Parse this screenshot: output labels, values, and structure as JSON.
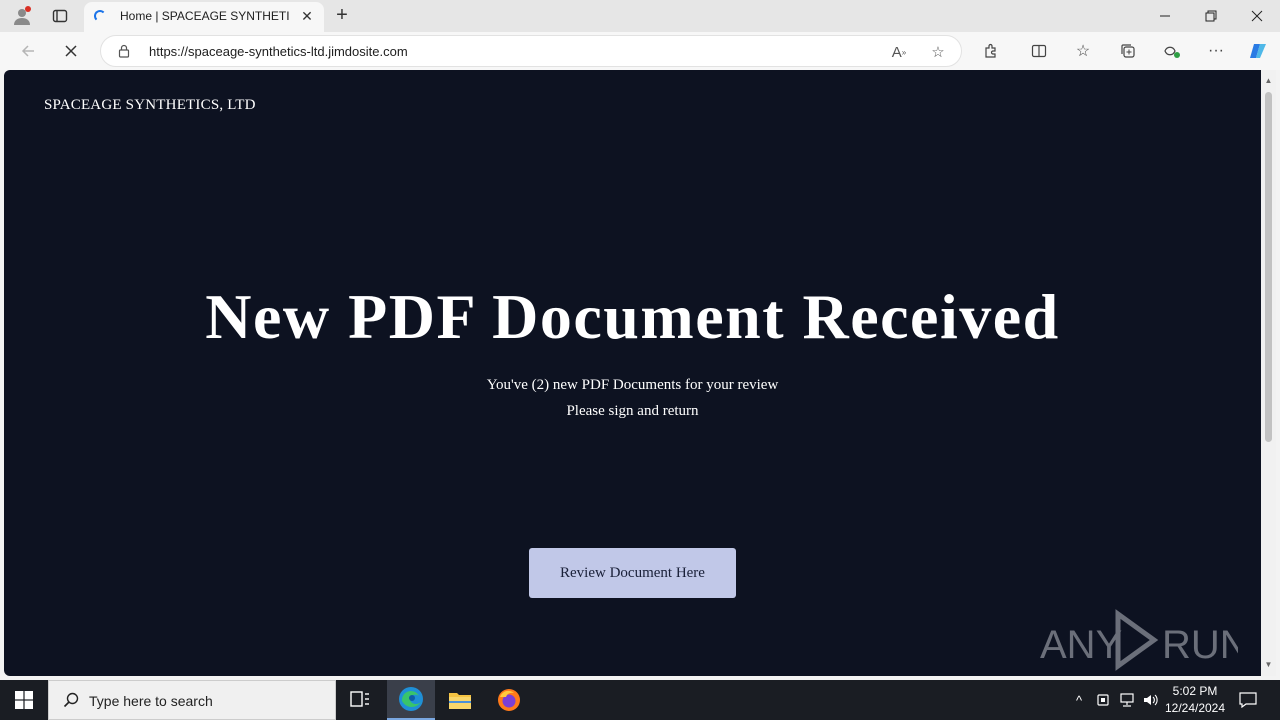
{
  "browser": {
    "tab": {
      "title": "Home | SPACEAGE SYNTHETICS, LTD"
    },
    "address_bar": {
      "url": "https://spaceage-synthetics-ltd.jimdosite.com"
    }
  },
  "page": {
    "brand": "SPACEAGE SYNTHETICS, LTD",
    "headline": "New PDF Document Received",
    "message_line1": "You've (2) new PDF Documents for your review",
    "message_line2": "Please sign and return",
    "cta_label": "Review Document Here",
    "background_color": "#0d1221",
    "button_color": "#c1c8e8"
  },
  "watermark": {
    "text": "ANY RUN"
  },
  "taskbar": {
    "search_placeholder": "Type here to search",
    "time": "5:02 PM",
    "date": "12/24/2024"
  }
}
